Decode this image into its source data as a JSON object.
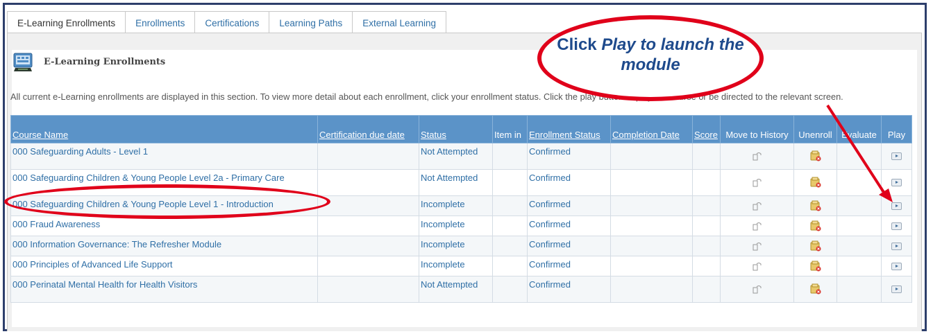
{
  "tabs": [
    {
      "label": "E-Learning Enrollments"
    },
    {
      "label": "Enrollments"
    },
    {
      "label": "Certifications"
    },
    {
      "label": "Learning Paths"
    },
    {
      "label": "External Learning"
    }
  ],
  "section": {
    "title": "E-Learning Enrollments",
    "description": "All current e-Learning enrollments are displayed in this section. To view more detail about each enrollment, click your enrollment status. Click the play button to play the course or be directed to the relevant screen."
  },
  "table": {
    "headers": {
      "course_name": "Course Name",
      "cert_due": "Certification due date",
      "status": "Status",
      "item_in": "Item in",
      "enroll_status": "Enrollment Status",
      "completion": "Completion Date",
      "score": "Score",
      "move": "Move to History",
      "unenroll": "Unenroll",
      "evaluate": "Evaluate",
      "play": "Play"
    },
    "rows": [
      {
        "course": "000 Safeguarding Adults - Level 1",
        "status": "Not Attempted",
        "enroll": "Confirmed"
      },
      {
        "course": "000 Safeguarding Children & Young People Level 2a - Primary Care",
        "status": "Not Attempted",
        "enroll": "Confirmed"
      },
      {
        "course": "000 Safeguarding Children & Young People Level 1 - Introduction",
        "status": "Incomplete",
        "enroll": "Confirmed"
      },
      {
        "course": "000 Fraud Awareness",
        "status": "Incomplete",
        "enroll": "Confirmed"
      },
      {
        "course": "000 Information Governance: The Refresher Module",
        "status": "Incomplete",
        "enroll": "Confirmed"
      },
      {
        "course": "000 Principles of Advanced Life Support",
        "status": "Incomplete",
        "enroll": "Confirmed"
      },
      {
        "course": "000 Perinatal Mental Health for Health Visitors",
        "status": "Not Attempted",
        "enroll": "Confirmed"
      }
    ]
  },
  "callout": {
    "lead": "Click",
    "emph": "Play to launch the module"
  },
  "colors": {
    "header_bg": "#5b93c8",
    "link": "#2f6fa6",
    "annotation": "#e0001a",
    "callout_text": "#1e4a8c",
    "frame": "#2d3e6b"
  }
}
